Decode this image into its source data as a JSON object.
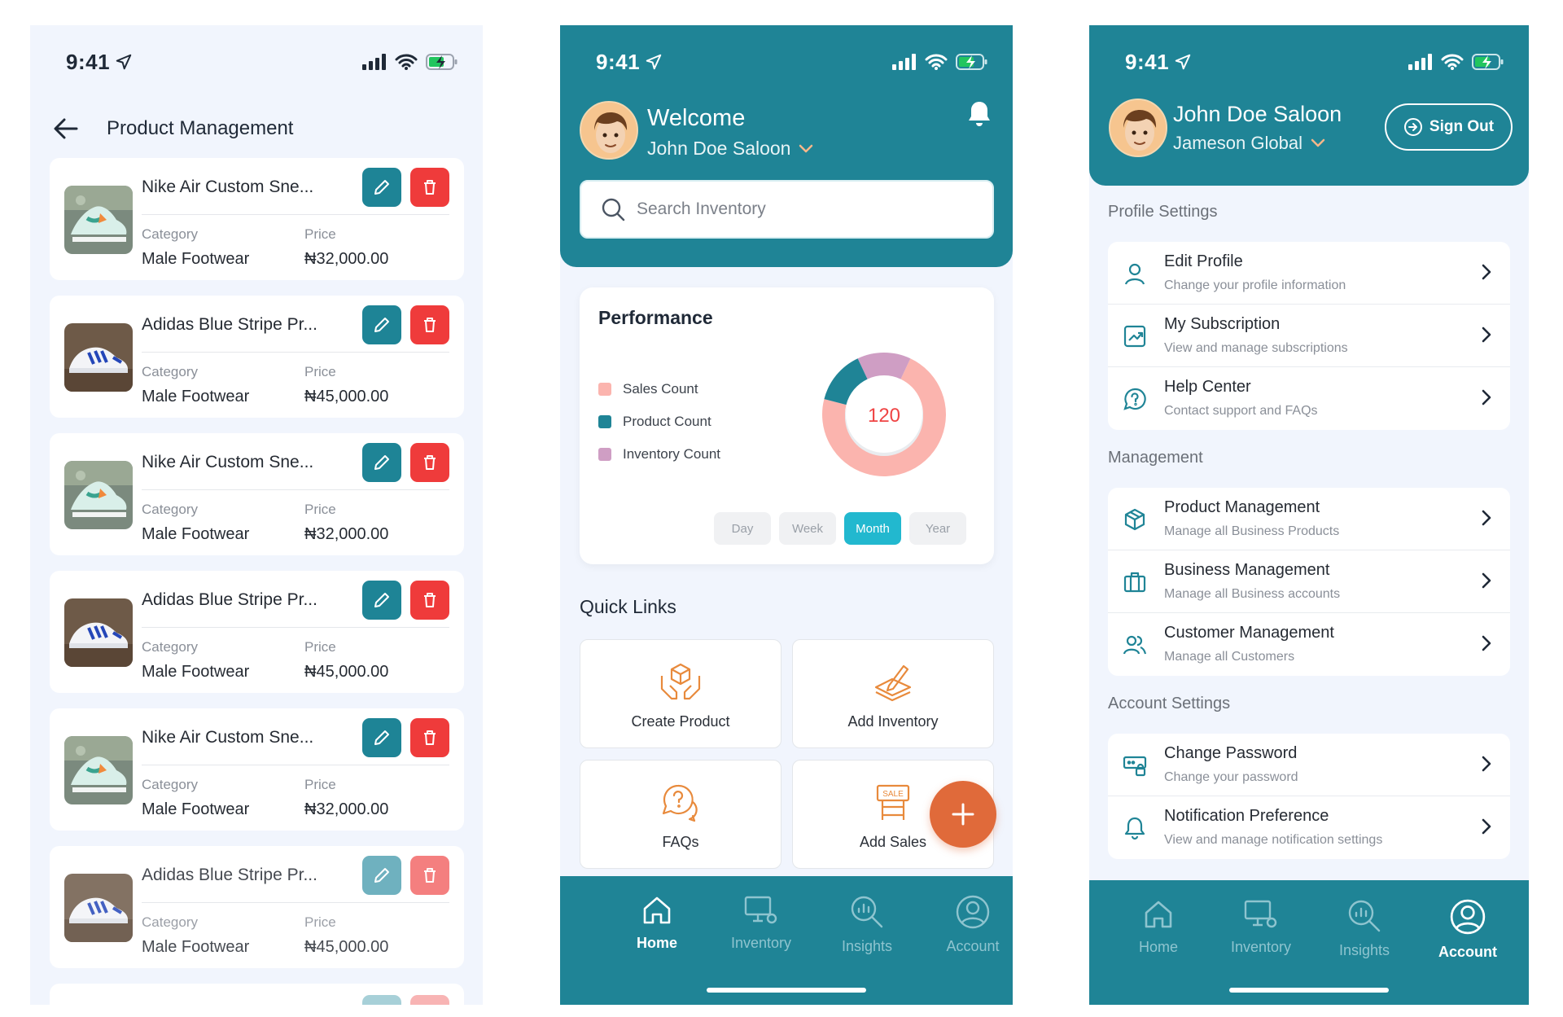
{
  "status": {
    "time": "9:41"
  },
  "product_screen": {
    "title": "Product Management",
    "category_label": "Category",
    "price_label": "Price",
    "products": [
      {
        "name": "Nike Air Custom Sne...",
        "category": "Male Footwear",
        "price": "₦32,000.00",
        "image": "nike-sneaker"
      },
      {
        "name": "Adidas Blue Stripe Pr...",
        "category": "Male Footwear",
        "price": "₦45,000.00",
        "image": "adidas-sneaker"
      },
      {
        "name": "Nike Air Custom Sne...",
        "category": "Male Footwear",
        "price": "₦32,000.00",
        "image": "nike-sneaker"
      },
      {
        "name": "Adidas Blue Stripe Pr...",
        "category": "Male Footwear",
        "price": "₦45,000.00",
        "image": "adidas-sneaker"
      },
      {
        "name": "Nike Air Custom Sne...",
        "category": "Male Footwear",
        "price": "₦32,000.00",
        "image": "nike-sneaker"
      },
      {
        "name": "Adidas Blue Stripe Pr...",
        "category": "Male Footwear",
        "price": "₦45,000.00",
        "image": "adidas-sneaker"
      }
    ]
  },
  "home_screen": {
    "welcome": "Welcome",
    "user": "John Doe Saloon",
    "search_placeholder": "Search Inventory",
    "performance": {
      "title": "Performance",
      "center_value": "120",
      "legend": [
        {
          "label": "Sales Count",
          "color": "#fbb4ae"
        },
        {
          "label": "Product Count",
          "color": "#1f8496"
        },
        {
          "label": "Inventory Count",
          "color": "#cf9ec4"
        }
      ],
      "donut_fractions": [
        0.14,
        0.14,
        0.72
      ],
      "periods": [
        "Day",
        "Week",
        "Month",
        "Year"
      ],
      "active_period": "Month"
    },
    "quick_links_title": "Quick Links",
    "quick_links": [
      "Create Product",
      "Add Inventory",
      "FAQs",
      "Add Sales"
    ]
  },
  "tabs": [
    "Home",
    "Inventory",
    "Insights",
    "Account"
  ],
  "account_screen": {
    "name": "John Doe Saloon",
    "org": "Jameson Global",
    "sign_out": "Sign Out",
    "profile_settings_title": "Profile Settings",
    "profile_settings": [
      {
        "title": "Edit Profile",
        "subtitle": "Change your profile information",
        "icon": "user-icon"
      },
      {
        "title": "My Subscription",
        "subtitle": "View and manage subscriptions",
        "icon": "chart-card-icon"
      },
      {
        "title": "Help Center",
        "subtitle": "Contact support and FAQs",
        "icon": "help-bubble-icon"
      }
    ],
    "management_title": "Management",
    "management": [
      {
        "title": "Product Management",
        "subtitle": "Manage all Business Products",
        "icon": "box-icon"
      },
      {
        "title": "Business Management",
        "subtitle": "Manage all Business accounts",
        "icon": "briefcase-icon"
      },
      {
        "title": "Customer Management",
        "subtitle": "Manage all Customers",
        "icon": "users-icon"
      }
    ],
    "account_settings_title": "Account Settings",
    "account_settings": [
      {
        "title": "Change Password",
        "subtitle": "Change your password",
        "icon": "password-icon"
      },
      {
        "title": "Notification Preference",
        "subtitle": "View and manage notification settings",
        "icon": "bell-icon"
      }
    ]
  },
  "colors": {
    "primary": "#1f8496",
    "danger": "#ef3b3b",
    "accent": "#e06a3a",
    "active_tab": "#22b8cf"
  }
}
